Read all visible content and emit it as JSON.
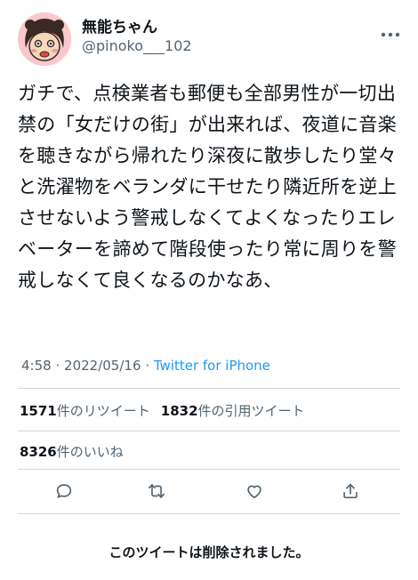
{
  "user": {
    "display_name": "無能ちゃん",
    "handle": "@pinoko___102",
    "avatar_icon": "cartoon-avatar-icon",
    "more_icon": "more-options-icon"
  },
  "tweet": {
    "text": "ガチで、点検業者も郵便も全部男性が一切出禁の「女だけの街」が出来れば、夜道に音楽を聴きながら帰れたり深夜に散歩したり堂々と洗濯物をベランダに干せたり隣近所を逆上させないよう警戒しなくてよくなったりエレベーターを諦めて階段使ったり常に周りを警戒しなくて良くなるのかなあ、",
    "time": "4:58",
    "date": "2022/05/16",
    "separator": "·",
    "source": "Twitter for iPhone"
  },
  "stats": {
    "retweets": "1571",
    "retweets_label": "件のリツイート",
    "quotes": "1832",
    "quotes_label": "件の引用ツイート",
    "likes": "8326",
    "likes_label": "件のいいね"
  },
  "actions": [
    "reply-icon",
    "retweet-icon",
    "like-icon",
    "share-icon"
  ],
  "notice": "このツイートは削除されました。",
  "colors": {
    "accent": "#1d9bf0",
    "muted": "#536471",
    "text": "#0f1419",
    "avatar_bg": "#f8c8cd"
  }
}
